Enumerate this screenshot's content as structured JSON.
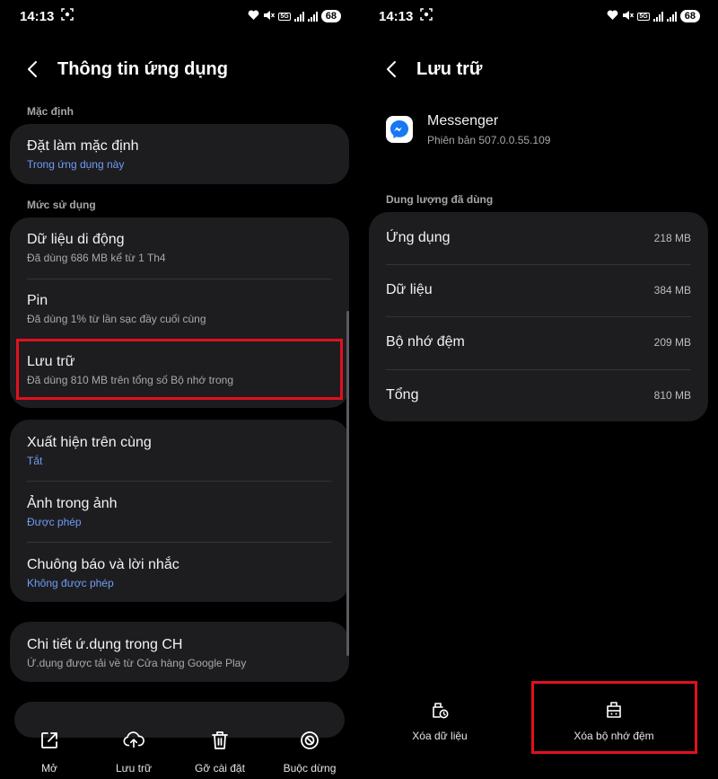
{
  "status": {
    "time": "14:13",
    "battery": "68",
    "network": "5G"
  },
  "left": {
    "title": "Thông tin ứng dụng",
    "section_default": "Mặc định",
    "set_default": {
      "title": "Đặt làm mặc định",
      "subtitle": "Trong ứng dụng này"
    },
    "section_usage": "Mức sử dụng",
    "mobile_data": {
      "title": "Dữ liệu di động",
      "subtitle": "Đã dùng 686 MB kể từ 1 Th4"
    },
    "battery": {
      "title": "Pin",
      "subtitle": "Đã dùng 1% từ lần sạc đầy cuối cùng"
    },
    "storage": {
      "title": "Lưu trữ",
      "subtitle": "Đã dùng 810 MB trên tổng số Bộ nhớ trong"
    },
    "appear_on_top": {
      "title": "Xuất hiện trên cùng",
      "subtitle": "Tắt"
    },
    "pip": {
      "title": "Ảnh trong ảnh",
      "subtitle": "Được phép"
    },
    "alarms": {
      "title": "Chuông báo và lời nhắc",
      "subtitle": "Không được phép"
    },
    "store_details": {
      "title": "Chi tiết ứ.dụng trong CH",
      "subtitle": "Ứ.dụng được tải về từ Cửa hàng Google Play"
    },
    "nav": [
      {
        "label": "Mở",
        "icon": "open-external-icon"
      },
      {
        "label": "Lưu trữ",
        "icon": "cloud-upload-icon"
      },
      {
        "label": "Gỡ cài đặt",
        "icon": "trash-icon"
      },
      {
        "label": "Buộc dừng",
        "icon": "force-stop-icon"
      }
    ]
  },
  "right": {
    "title": "Lưu trữ",
    "app": {
      "name": "Messenger",
      "version": "Phiên bản 507.0.0.55.109",
      "icon": "messenger-icon"
    },
    "section_used": "Dung lượng đã dùng",
    "storage_rows": [
      {
        "label": "Ứng dụng",
        "value": "218 MB"
      },
      {
        "label": "Dữ liệu",
        "value": "384 MB"
      },
      {
        "label": "Bộ nhớ đệm",
        "value": "209 MB"
      },
      {
        "label": "Tổng",
        "value": "810 MB"
      }
    ],
    "actions": [
      {
        "label": "Xóa dữ liệu",
        "icon": "clear-data-icon"
      },
      {
        "label": "Xóa bộ nhớ đệm",
        "icon": "clear-cache-icon"
      }
    ]
  },
  "colors": {
    "background": "#000000",
    "card": "#1d1d20",
    "accent_blue": "#6f9df5",
    "highlight_red": "#e0111e"
  }
}
